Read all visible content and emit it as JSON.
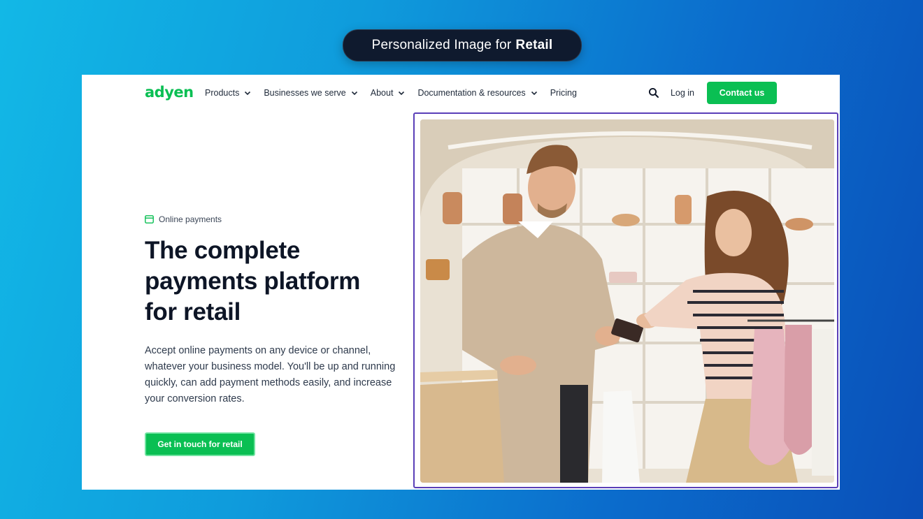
{
  "banner": {
    "prefix": "Personalized Image for",
    "highlight": "Retail"
  },
  "brand": {
    "logo": "adyen",
    "color": "#0abf53"
  },
  "nav": {
    "items": [
      {
        "label": "Products",
        "has_dropdown": true
      },
      {
        "label": "Businesses we serve",
        "has_dropdown": true
      },
      {
        "label": "About",
        "has_dropdown": true
      },
      {
        "label": "Documentation & resources",
        "has_dropdown": true
      },
      {
        "label": "Pricing",
        "has_dropdown": false
      }
    ],
    "search_icon": "search-icon",
    "login_label": "Log in",
    "contact_label": "Contact us"
  },
  "hero": {
    "eyebrow_icon": "card-icon",
    "eyebrow": "Online payments",
    "headline_l1": "The complete",
    "headline_l2": "payments platform",
    "headline_l3": "for retail",
    "description": "Accept online payments on any device or channel, whatever your business model. You'll be up and running quickly, can add payment methods easily, and increase your conversion rates.",
    "cta_label": "Get in touch for retail"
  },
  "image": {
    "subject": "retail-store-card-payment-photo"
  }
}
